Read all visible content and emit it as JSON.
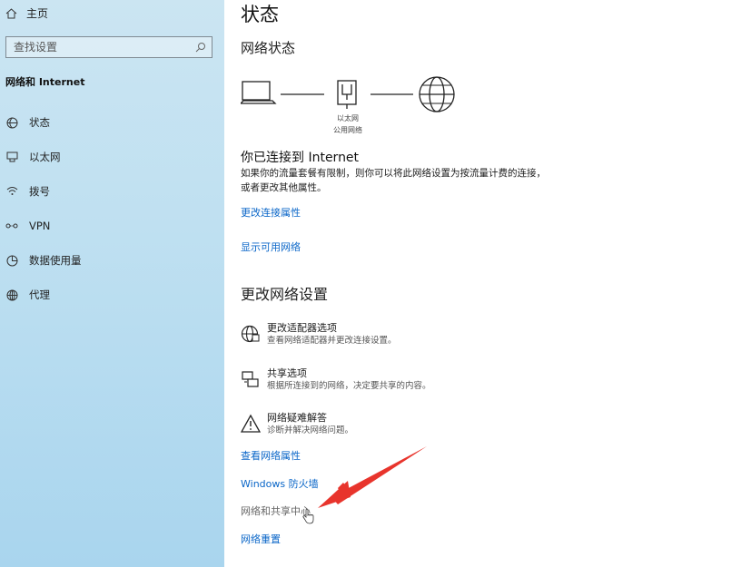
{
  "sidebar": {
    "home_label": "主页",
    "search_placeholder": "查找设置",
    "section_title": "网络和 Internet",
    "items": [
      {
        "label": "状态",
        "icon": "status-icon"
      },
      {
        "label": "以太网",
        "icon": "ethernet-icon"
      },
      {
        "label": "拨号",
        "icon": "dialup-icon"
      },
      {
        "label": "VPN",
        "icon": "vpn-icon"
      },
      {
        "label": "数据使用量",
        "icon": "data-usage-icon"
      },
      {
        "label": "代理",
        "icon": "proxy-icon"
      }
    ]
  },
  "main": {
    "title": "状态",
    "network_status_heading": "网络状态",
    "diagram": {
      "adapter_name": "以太网",
      "network_type": "公用网络"
    },
    "connected_title": "你已连接到 Internet",
    "connected_desc": "如果你的流量套餐有限制，则你可以将此网络设置为按流量计费的连接，或者更改其他属性。",
    "link_change_props": "更改连接属性",
    "link_show_networks": "显示可用网络",
    "change_settings_heading": "更改网络设置",
    "options": [
      {
        "title": "更改适配器选项",
        "desc": "查看网络适配器并更改连接设置。",
        "icon": "adapter-icon"
      },
      {
        "title": "共享选项",
        "desc": "根据所连接到的网络，决定要共享的内容。",
        "icon": "sharing-icon"
      },
      {
        "title": "网络疑难解答",
        "desc": "诊断并解决网络问题。",
        "icon": "warning-icon"
      }
    ],
    "link_view_props": "查看网络属性",
    "link_firewall": "Windows 防火墙",
    "link_sharing_center": "网络和共享中心",
    "link_reset": "网络重置"
  },
  "colors": {
    "link": "#0a66c8",
    "sidebar": "#bfe0f1",
    "annotation_arrow": "#e8342c"
  }
}
